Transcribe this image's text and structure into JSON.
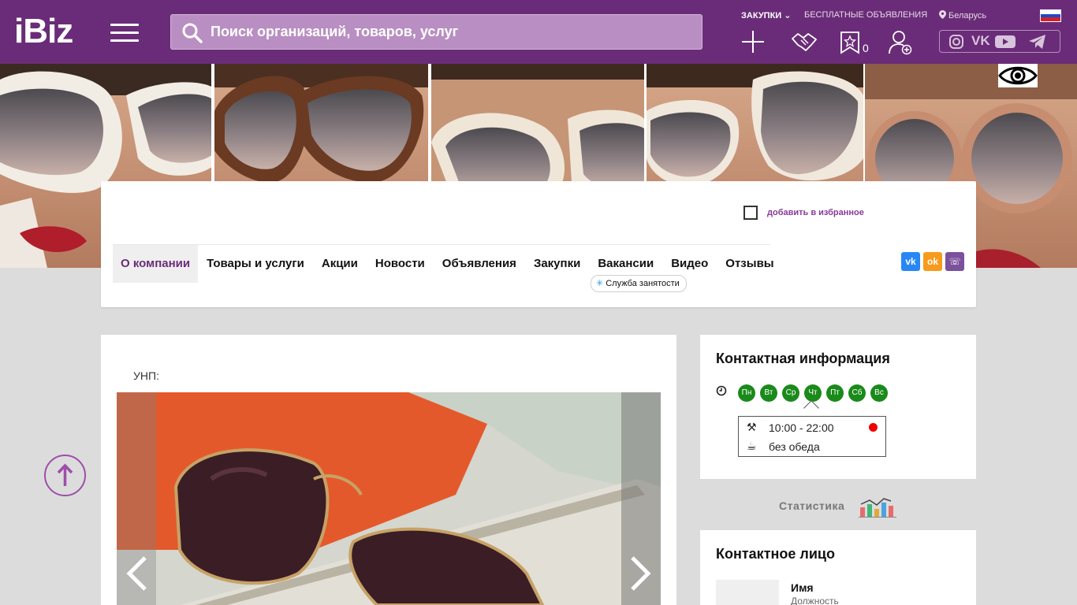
{
  "header": {
    "logo": "iBiz",
    "search_placeholder": "Поиск организаций, товаров, услуг",
    "links": {
      "purchases": "ЗАКУПКИ",
      "free_ads": "БЕСПЛАТНЫЕ ОБЪЯВЛЕНИЯ",
      "region": "Беларусь"
    },
    "favorites_count": "0",
    "social": [
      "instagram-icon",
      "vk-icon",
      "youtube-icon",
      "telegram-icon"
    ]
  },
  "company": {
    "add_favorite": "добавить в избранное",
    "tabs": [
      "О компании",
      "Товары и услуги",
      "Акции",
      "Новости",
      "Объявления",
      "Закупки",
      "Вакансии",
      "Видео",
      "Отзывы"
    ],
    "active_tab": "О компании",
    "employment_service": "Служба занятости",
    "share": {
      "vk": "vk",
      "ok": "ok",
      "viber": "viber"
    }
  },
  "main": {
    "unp_label": "УНП:"
  },
  "contact": {
    "title": "Контактная информация",
    "days": [
      "Пн",
      "Вт",
      "Ср",
      "Чт",
      "Пт",
      "Сб",
      "Вс"
    ],
    "hours": "10:00 - 22:00",
    "lunch": "без обеда"
  },
  "stats_label": "Статистика",
  "person": {
    "title": "Контактное лицо",
    "name": "Имя",
    "position": "Должность"
  },
  "colors": {
    "brand": "#6a2c78",
    "day_green": "#1a8a1a",
    "status_red": "#e00000"
  }
}
